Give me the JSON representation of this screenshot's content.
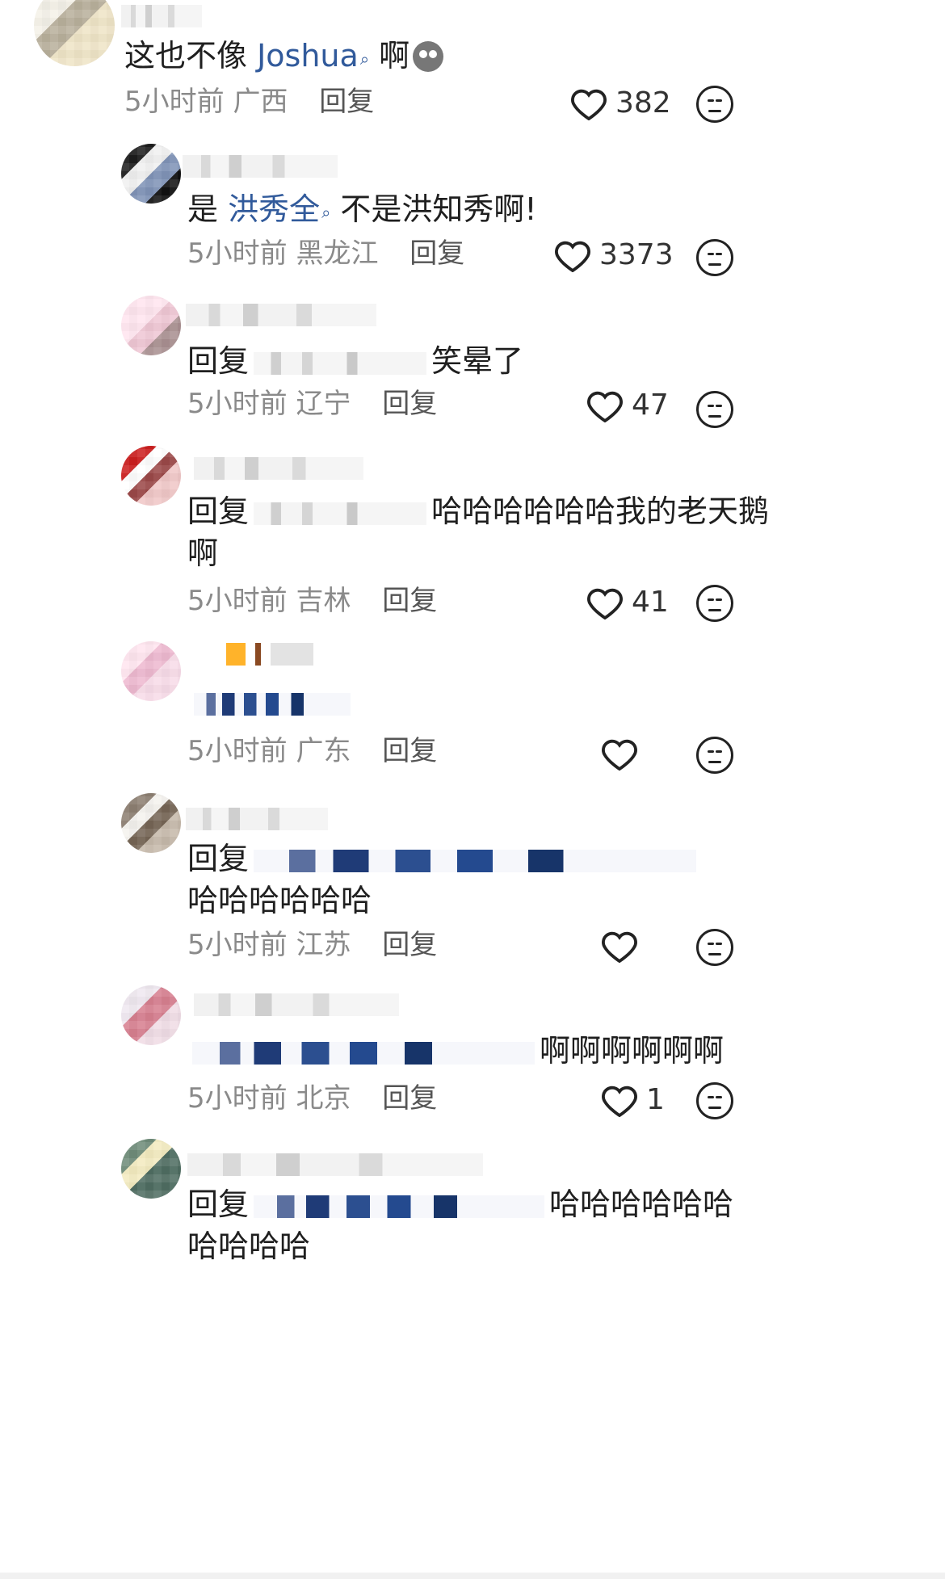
{
  "comments": [
    {
      "text_prefix": "这也不像 ",
      "mention": "Joshua",
      "text_suffix": " 啊",
      "time": "5小时前",
      "location": "广西",
      "reply": "回复",
      "likes": "382"
    },
    {
      "text_prefix": "是 ",
      "mention": "洪秀全",
      "text_suffix": " 不是洪知秀啊!",
      "time": "5小时前",
      "location": "黑龙江",
      "reply": "回复",
      "likes": "3373"
    },
    {
      "text_prefix": "回复",
      "text_suffix": "笑晕了",
      "time": "5小时前",
      "location": "辽宁",
      "reply": "回复",
      "likes": "47"
    },
    {
      "text_prefix": "回复",
      "text_suffix": "哈哈哈哈哈哈我的老天鹅",
      "text_line2": "啊",
      "time": "5小时前",
      "location": "吉林",
      "reply": "回复",
      "likes": "41"
    },
    {
      "time": "5小时前",
      "location": "广东",
      "reply": "回复",
      "likes": ""
    },
    {
      "text_prefix": "回复",
      "text_line2": "哈哈哈哈哈哈",
      "time": "5小时前",
      "location": "江苏",
      "reply": "回复",
      "likes": ""
    },
    {
      "text_suffix": "啊啊啊啊啊啊",
      "time": "5小时前",
      "location": "北京",
      "reply": "回复",
      "likes": "1"
    },
    {
      "text_prefix": "回复",
      "text_suffix": "哈哈哈哈哈哈",
      "text_line2": "哈哈哈哈",
      "time": "",
      "location": "",
      "reply": "",
      "likes": ""
    }
  ],
  "icons": {
    "like": "heart-icon",
    "dislike": "dislike-face-icon",
    "emoji": "sad-face-emoji-icon"
  }
}
